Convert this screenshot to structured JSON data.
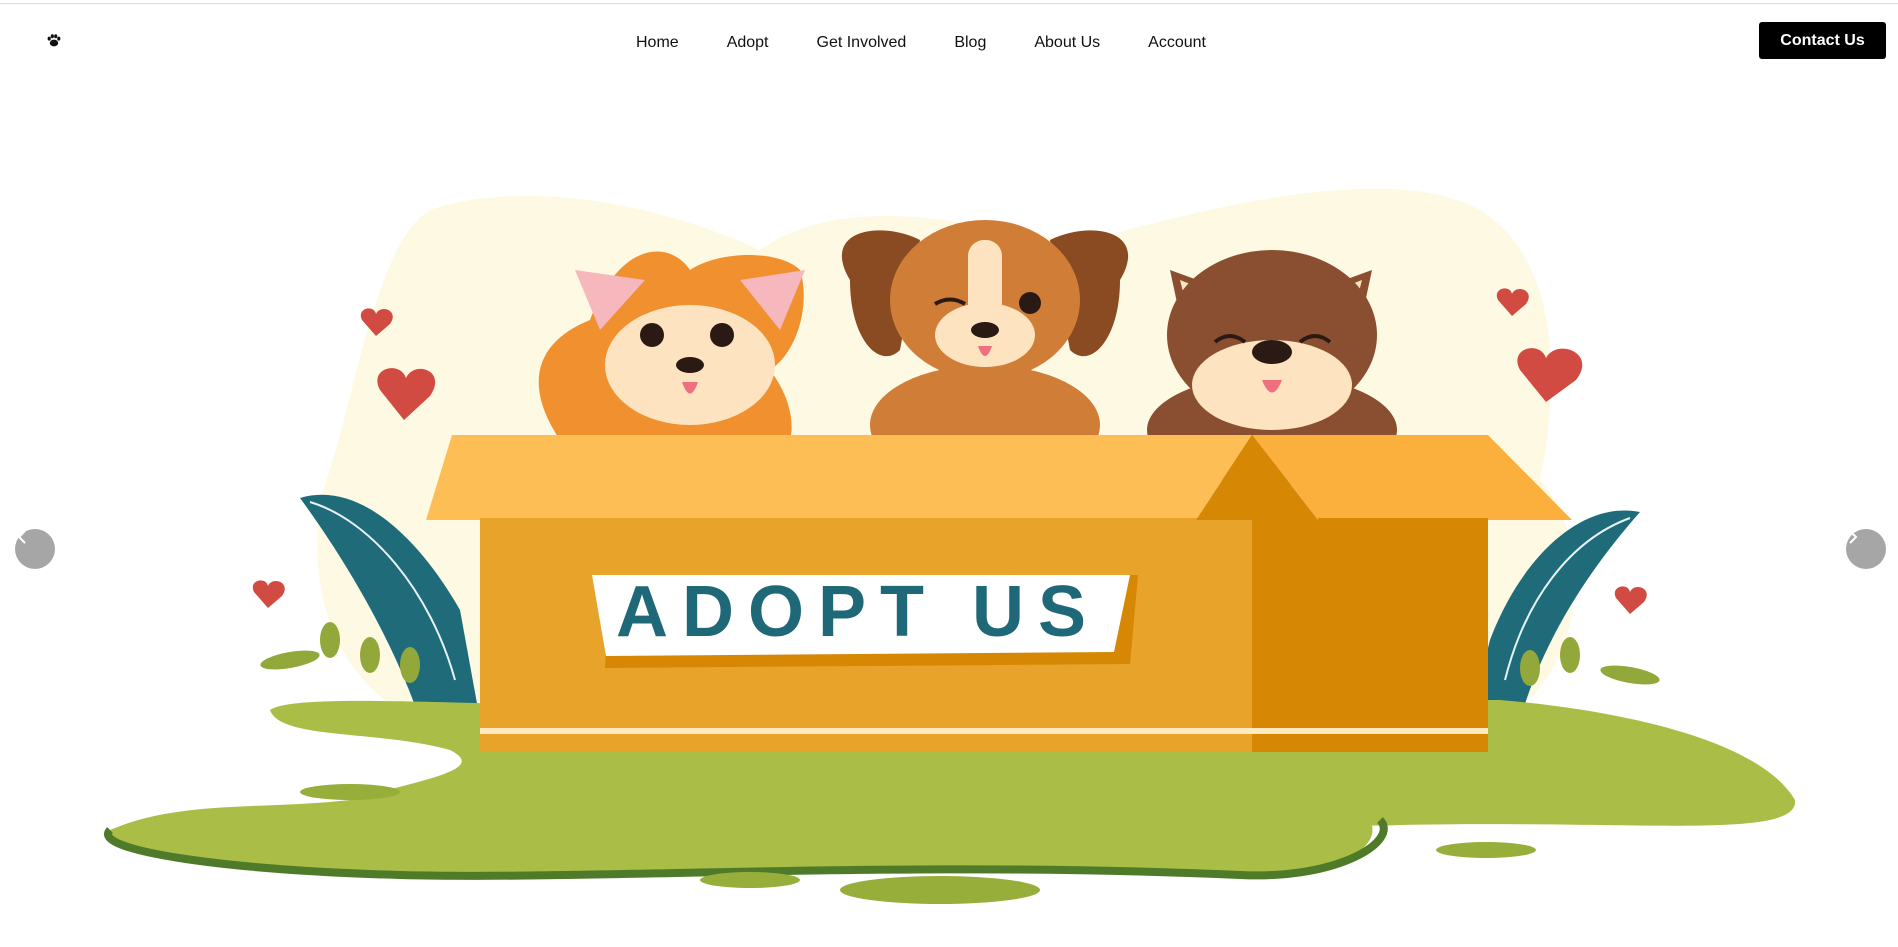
{
  "header": {
    "logo_icon": "paw-icon",
    "nav": [
      {
        "label": "Home"
      },
      {
        "label": "Adopt"
      },
      {
        "label": "Get Involved"
      },
      {
        "label": "Blog"
      },
      {
        "label": "About Us"
      },
      {
        "label": "Account"
      }
    ],
    "contact_label": "Contact Us"
  },
  "hero": {
    "banner_text": "ADOPT US",
    "prev_icon": "chevron-left-icon",
    "next_icon": "chevron-right-icon"
  },
  "colors": {
    "nav_text": "#111111",
    "button_bg": "#000000",
    "button_text": "#ffffff",
    "carousel_button": "#a6a6a6",
    "box_orange": "#e8a32a",
    "grass_green": "#a9bd45",
    "leaf_teal": "#1f6b7a",
    "heart_red": "#d24b42",
    "banner_text_teal": "#1e6878"
  }
}
